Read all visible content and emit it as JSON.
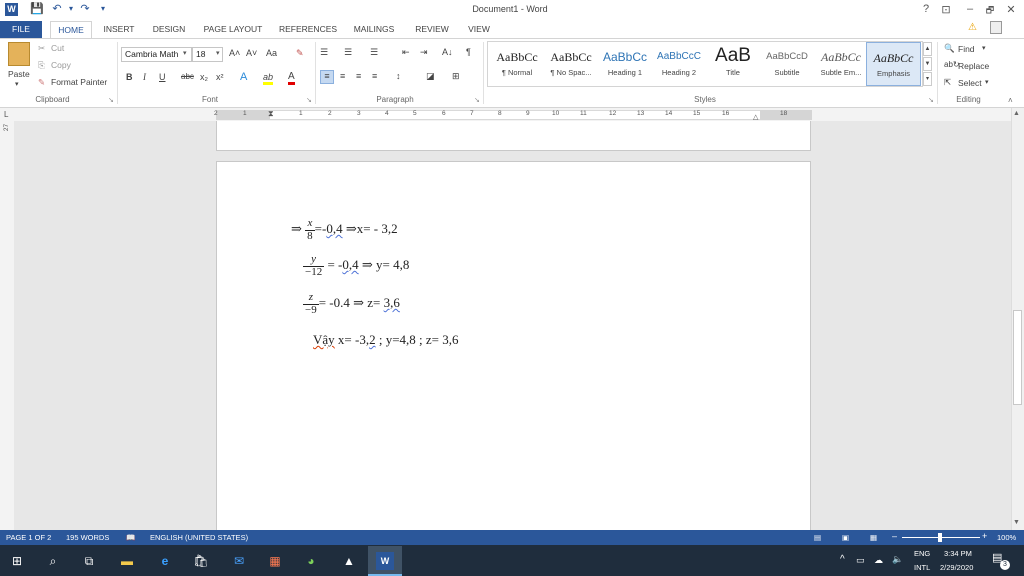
{
  "window": {
    "title": "Document1 - Word",
    "controls": {
      "help": "?",
      "ribbon_display": "⊡",
      "minimize": "–",
      "restore": "🗗",
      "close": "✕"
    }
  },
  "quick_access": {
    "save": "💾",
    "undo": "↶",
    "redo": "↷",
    "customize": "▾"
  },
  "tabs": [
    "FILE",
    "HOME",
    "INSERT",
    "DESIGN",
    "PAGE LAYOUT",
    "REFERENCES",
    "MAILINGS",
    "REVIEW",
    "VIEW"
  ],
  "active_tab": "HOME",
  "clipboard": {
    "paste": "Paste",
    "cut": "Cut",
    "copy": "Copy",
    "format_painter": "Format Painter",
    "group": "Clipboard"
  },
  "font": {
    "family": "Cambria Math",
    "size": "18",
    "grow": "A˄",
    "shrink": "A˅",
    "change_case": "Aa",
    "clear": "✎",
    "bold": "B",
    "italic": "I",
    "underline": "U",
    "strike": "abc",
    "subscript": "x₂",
    "superscript": "x²",
    "text_effects": "A",
    "highlight": "ab",
    "font_color": "A",
    "group": "Font"
  },
  "paragraph": {
    "bullets": "☰",
    "numbering": "☰",
    "multilevel": "☰",
    "decrease_indent": "⇤",
    "increase_indent": "⇥",
    "sort": "A↓",
    "show_marks": "¶",
    "align_left": "≡",
    "center": "≡",
    "align_right": "≡",
    "justify": "≡",
    "line_spacing": "↕",
    "shading": "◪",
    "borders": "⊞",
    "group": "Paragraph"
  },
  "styles": {
    "items": [
      {
        "preview": "AaBbCc",
        "name": "¶ Normal"
      },
      {
        "preview": "AaBbCc",
        "name": "¶ No Spac..."
      },
      {
        "preview": "AaBbCc",
        "name": "Heading 1"
      },
      {
        "preview": "AaBbCcC",
        "name": "Heading 2"
      },
      {
        "preview": "AaB",
        "name": "Title"
      },
      {
        "preview": "AaBbCcD",
        "name": "Subtitle"
      },
      {
        "preview": "AaBbCc",
        "name": "Subtle Em..."
      },
      {
        "preview": "AaBbCc",
        "name": "Emphasis"
      }
    ],
    "selected": "Emphasis",
    "group": "Styles"
  },
  "editing": {
    "find": "Find",
    "replace": "Replace",
    "select": "Select",
    "group": "Editing"
  },
  "ruler": {
    "labels": [
      "2",
      "1",
      "1",
      "2",
      "3",
      "4",
      "5",
      "6",
      "7",
      "8",
      "9",
      "10",
      "11",
      "12",
      "13",
      "14",
      "15",
      "16",
      "18"
    ],
    "vertical_label": "27"
  },
  "document": {
    "lines": [
      {
        "arrow": "⇒",
        "num": "x",
        "den": "8",
        "mid": "=-",
        "val": "0,4",
        "tail": " ⇒x= - 3,2"
      },
      {
        "num": "y",
        "den": "−12",
        "mid": " = -",
        "val": "0,4",
        "tail": " ⇒ y= 4,8"
      },
      {
        "num": "z",
        "den": "−9",
        "mid": "= -0.4  ⇒ z= ",
        "val": "3,6",
        "tail": ""
      }
    ],
    "conclusion": {
      "word": "Vậy",
      "a": " x= -3,",
      "b": "2",
      "c": " ; y=4,8 ; z= 3,6"
    }
  },
  "status": {
    "page": "PAGE 1 OF 2",
    "words": "195 WORDS",
    "language": "ENGLISH (UNITED STATES)",
    "zoom": "100%"
  },
  "taskbar": {
    "lang": "ENG",
    "layout": "INTL",
    "time": "3:34 PM",
    "date": "2/29/2020",
    "notifications": "3"
  },
  "colors": {
    "accent": "#2b579a",
    "taskbar": "#1f2d3d",
    "doc_bg": "#e7e7e7"
  }
}
